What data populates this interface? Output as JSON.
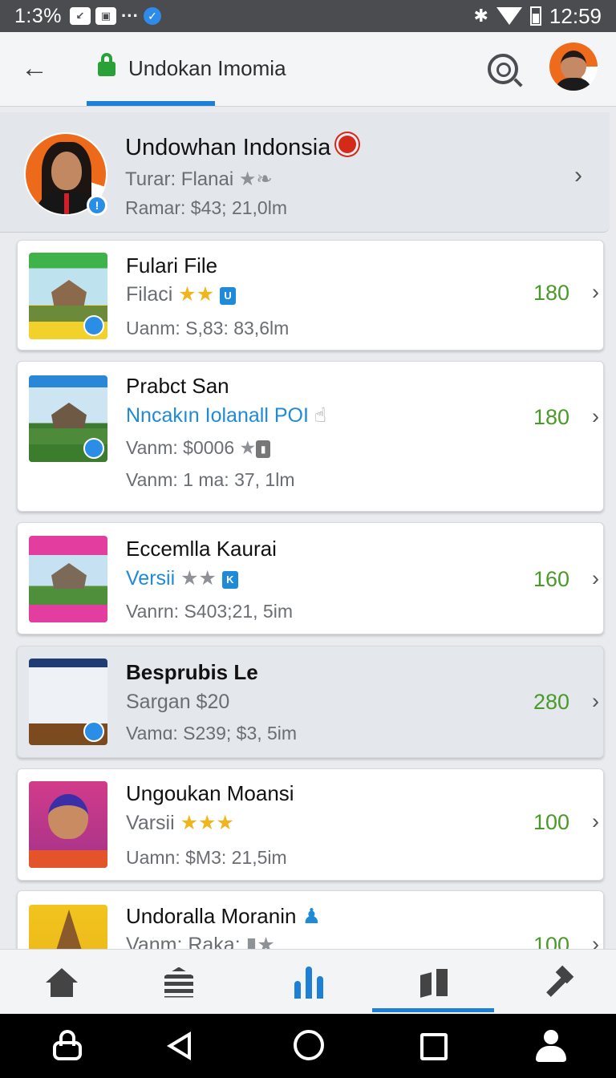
{
  "status_bar": {
    "time_left": "1:3%",
    "dots": "···",
    "time_right": "12:59"
  },
  "app_bar": {
    "title": "Undokan Imomia"
  },
  "profile": {
    "name": "Undowhan Indonsia",
    "subtitle": "Turar: Flanai",
    "meta": "Ramar: $43; 21,0lm",
    "badge": "!"
  },
  "items": [
    {
      "title": "Fulari File",
      "subtitle": "Filaci",
      "meta": "Uanm: S,83: 83,6lm",
      "count": "180",
      "badge": "U"
    },
    {
      "title": "Prabct San",
      "subtitle": "Nncakın Iolanall POI",
      "meta1": "Vanm: $0006",
      "meta": "Vanm: 1 ma: 37, 1lm",
      "count": "180"
    },
    {
      "title": "Eccemlla Kaurai",
      "subtitle": "Versii",
      "meta": "Vanrn: S403;21, 5im",
      "count": "160",
      "badge": "K"
    },
    {
      "title": "Besprubis Le",
      "subtitle": "Sargan $20",
      "meta": "Vamɑ: S239; $3, 5im",
      "count": "280"
    },
    {
      "title": "Ungoukan Moansi",
      "subtitle": "Varsii",
      "meta": "Uamn: $M3: 21,5im",
      "count": "100"
    },
    {
      "title": "Undoralla Moranin",
      "subtitle": "Vanm: Raka:",
      "count": "100"
    }
  ],
  "colors": {
    "accent": "#1e7fd8",
    "count_green": "#4a9a2a",
    "link_blue": "#1f8ad8"
  }
}
